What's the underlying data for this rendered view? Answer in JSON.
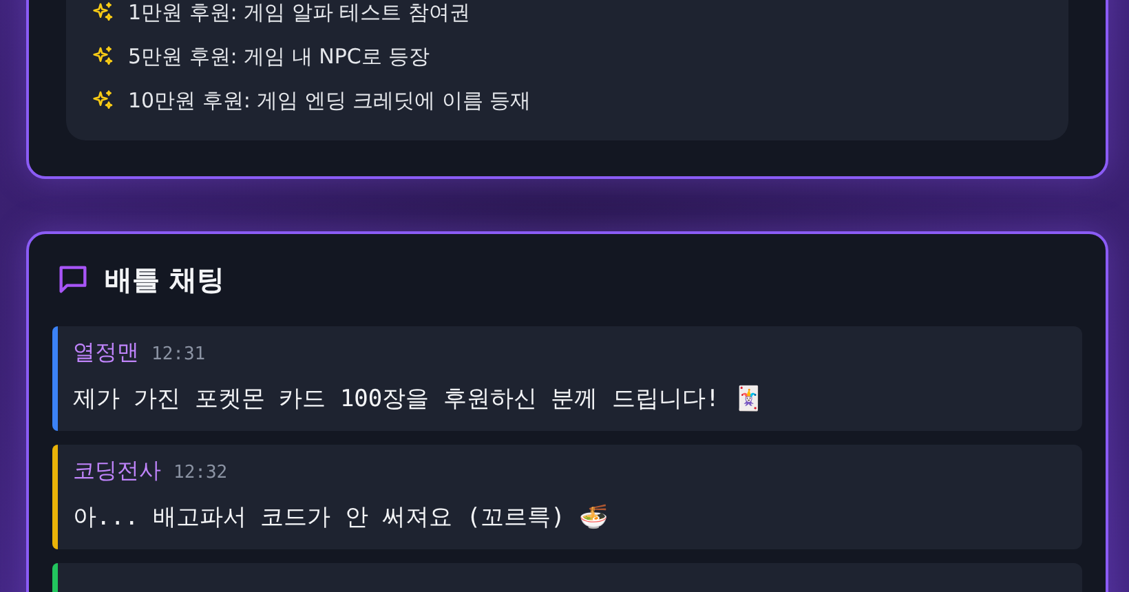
{
  "rewards": {
    "items": [
      {
        "text": "1만원 후원: 게임 알파 테스트 참여권"
      },
      {
        "text": "5만원 후원: 게임 내 NPC로 등장"
      },
      {
        "text": "10만원 후원: 게임 엔딩 크레딧에 이름 등재"
      }
    ]
  },
  "chat": {
    "title": "배틀 채팅",
    "messages": [
      {
        "user": "열정맨",
        "time": "12:31",
        "text": "제가 가진 포켓몬 카드 100장을 후원하신 분께 드립니다! 🃏",
        "color": "#3b82f6"
      },
      {
        "user": "코딩전사",
        "time": "12:32",
        "text": "아... 배고파서 코드가 안 써져요 (꼬르륵) 🍜",
        "color": "#eab308"
      },
      {
        "color": "#22c55e"
      }
    ]
  }
}
